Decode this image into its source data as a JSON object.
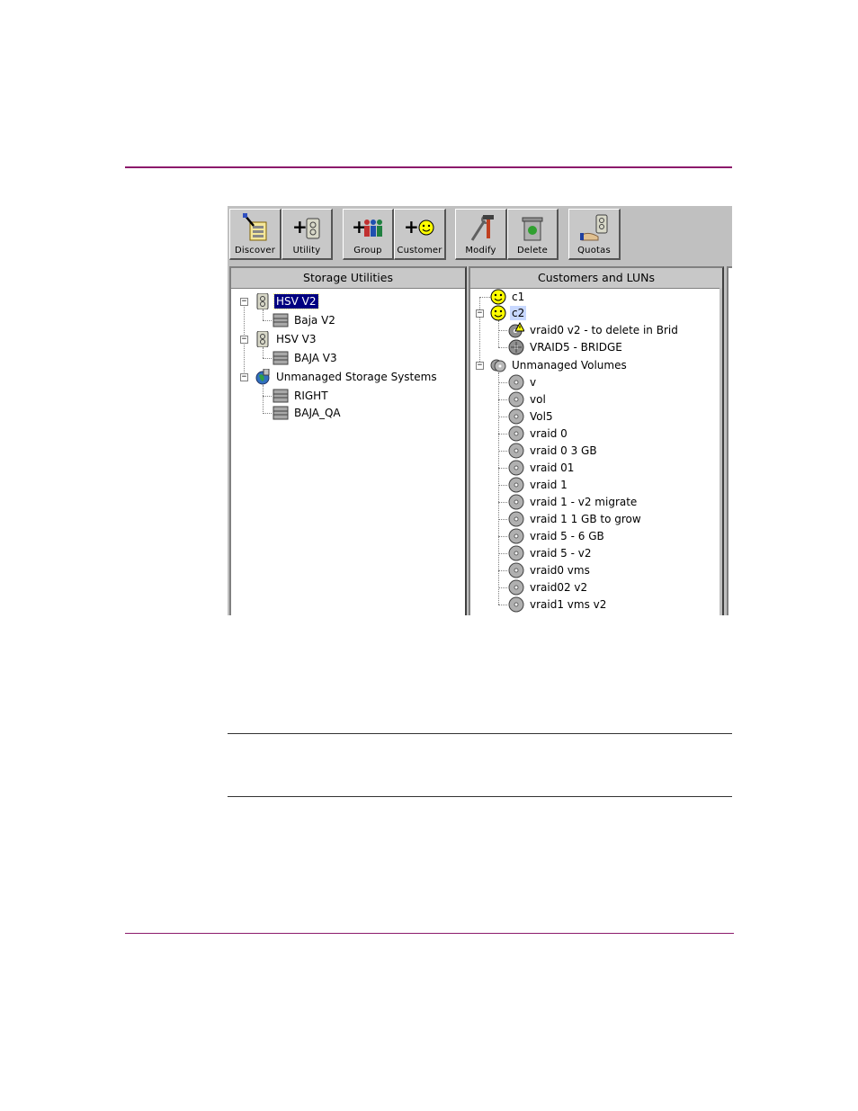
{
  "toolbar": {
    "buttons": [
      {
        "label": "Discover",
        "icon": "discover-icon"
      },
      {
        "label": "Utility",
        "icon": "add-utility-icon"
      },
      {
        "label": "Group",
        "icon": "add-group-icon"
      },
      {
        "label": "Customer",
        "icon": "add-customer-icon"
      },
      {
        "label": "Modify",
        "icon": "modify-icon"
      },
      {
        "label": "Delete",
        "icon": "delete-icon"
      },
      {
        "label": "Quotas",
        "icon": "quotas-icon"
      }
    ]
  },
  "left_pane": {
    "title": "Storage Utilities",
    "nodes": [
      {
        "label": "HSV V2",
        "icon": "storage-utility-icon"
      },
      {
        "label": "Baja V2",
        "icon": "storage-system-icon"
      },
      {
        "label": "HSV V3",
        "icon": "storage-utility-icon"
      },
      {
        "label": "BAJA V3",
        "icon": "storage-system-icon"
      },
      {
        "label": "Unmanaged Storage Systems",
        "icon": "unmanaged-globe-icon"
      },
      {
        "label": "RIGHT",
        "icon": "storage-system-icon"
      },
      {
        "label": "BAJA_QA",
        "icon": "storage-system-icon"
      }
    ]
  },
  "right_pane": {
    "title": "Customers and LUNs",
    "nodes": [
      {
        "label": "c1",
        "icon": "customer-smiley-icon"
      },
      {
        "label": "c2",
        "icon": "customer-smiley-icon"
      },
      {
        "label": "vraid0 v2 - to delete in Brid",
        "icon": "lun-warning-icon"
      },
      {
        "label": "VRAID5 - BRIDGE",
        "icon": "lun-disc-icon"
      },
      {
        "label": "Unmanaged Volumes",
        "icon": "unmanaged-volumes-icon"
      },
      {
        "label": "v",
        "icon": "volume-disc-icon"
      },
      {
        "label": "vol",
        "icon": "volume-disc-icon"
      },
      {
        "label": "Vol5",
        "icon": "volume-disc-icon"
      },
      {
        "label": "vraid 0",
        "icon": "volume-disc-icon"
      },
      {
        "label": "vraid 0 3 GB",
        "icon": "volume-disc-icon"
      },
      {
        "label": "vraid 01",
        "icon": "volume-disc-icon"
      },
      {
        "label": "vraid 1",
        "icon": "volume-disc-icon"
      },
      {
        "label": "vraid 1 - v2 migrate",
        "icon": "volume-disc-icon"
      },
      {
        "label": "vraid 1 1 GB to grow",
        "icon": "volume-disc-icon"
      },
      {
        "label": "vraid 5 - 6 GB",
        "icon": "volume-disc-icon"
      },
      {
        "label": "vraid 5 - v2",
        "icon": "volume-disc-icon"
      },
      {
        "label": "vraid0 vms",
        "icon": "volume-disc-icon"
      },
      {
        "label": "vraid02 v2",
        "icon": "volume-disc-icon"
      },
      {
        "label": "vraid1 vms v2",
        "icon": "volume-disc-icon"
      }
    ]
  },
  "colors": {
    "rule": "#8c1a6b",
    "selection": "#000080",
    "window": "#c0c0c0"
  }
}
